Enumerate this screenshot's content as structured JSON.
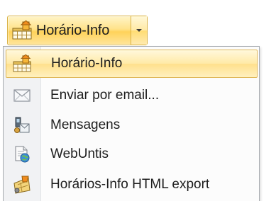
{
  "split_button": {
    "label": "Horário-Info",
    "icon": "timetable-icon",
    "arrow_icon": "chevron-down-icon"
  },
  "menu": {
    "items": [
      {
        "label": "Horário-Info",
        "icon": "timetable-icon",
        "highlighted": true
      },
      {
        "label": "Enviar por email...",
        "icon": "envelope-icon",
        "highlighted": false
      },
      {
        "label": "Mensagens",
        "icon": "messages-icon",
        "highlighted": false
      },
      {
        "label": "WebUntis",
        "icon": "web-document-icon",
        "highlighted": false
      },
      {
        "label": "Horários-Info HTML export",
        "icon": "html-export-icon",
        "highlighted": false
      }
    ]
  },
  "colors": {
    "highlight_border": "#e0b85a",
    "highlight_fill": "#ffe08c",
    "menu_border": "#a7abb0"
  }
}
